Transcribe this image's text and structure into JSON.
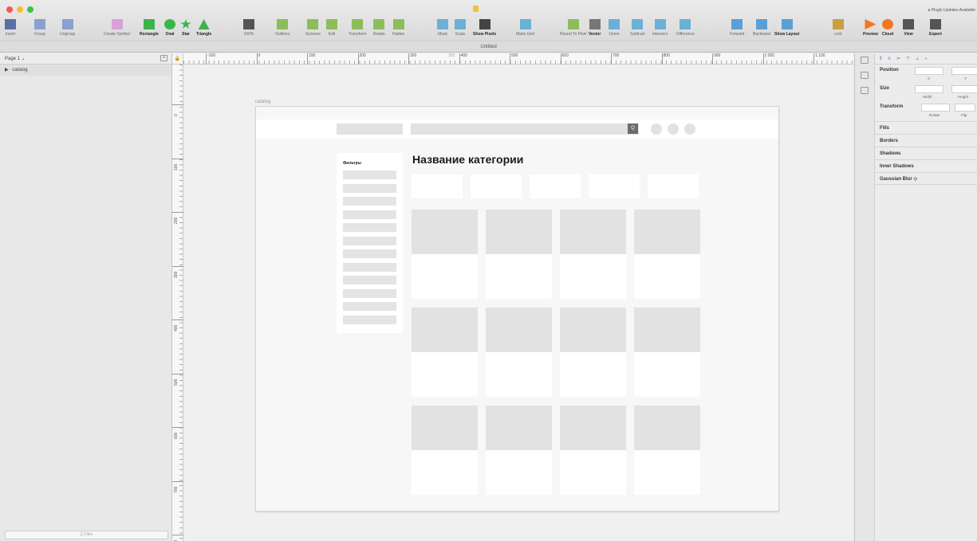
{
  "window": {
    "title": "Untitled",
    "notification": "● Plugin Updates Available"
  },
  "toolbar": {
    "tools": [
      {
        "label": "Insert",
        "icon": "plus-dropdown-icon",
        "color": "#5a6fa8"
      },
      {
        "label": "Group",
        "icon": "group-icon",
        "color": "#8aa0cf"
      },
      {
        "label": "Ungroup",
        "icon": "ungroup-icon",
        "color": "#8aa0cf"
      },
      {
        "label": "Create Symbol",
        "icon": "symbol-icon",
        "color": "#d9a0d9"
      },
      {
        "label": "Rectangle",
        "icon": "rectangle-icon",
        "color": "#3cb44b"
      },
      {
        "label": "Oval",
        "icon": "oval-icon",
        "color": "#3cb44b"
      },
      {
        "label": "Star",
        "icon": "star-icon",
        "color": "#3cb44b"
      },
      {
        "label": "Triangle",
        "icon": "triangle-icon",
        "color": "#3cb44b"
      },
      {
        "label": "100%",
        "icon": "zoom-icon",
        "color": "#555555"
      },
      {
        "label": "Outlines",
        "icon": "outlines-icon",
        "color": "#8dbd5a"
      },
      {
        "label": "Scissors",
        "icon": "scissors-icon",
        "color": "#8dbd5a"
      },
      {
        "label": "Edit",
        "icon": "edit-icon",
        "color": "#8dbd5a"
      },
      {
        "label": "Transform",
        "icon": "transform-icon",
        "color": "#8dbd5a"
      },
      {
        "label": "Rotate",
        "icon": "rotate-icon",
        "color": "#8dbd5a"
      },
      {
        "label": "Flatten",
        "icon": "flatten-icon",
        "color": "#8dbd5a"
      },
      {
        "label": "Mask",
        "icon": "mask-icon",
        "color": "#6bb0d6"
      },
      {
        "label": "Scale",
        "icon": "scale-icon",
        "color": "#6bb0d6"
      },
      {
        "label": "Show Pixels",
        "icon": "pixels-icon",
        "color": "#444444"
      },
      {
        "label": "Make Grid",
        "icon": "grid-icon",
        "color": "#6bb0d6"
      },
      {
        "label": "Round To Pixel",
        "icon": "round-pixel-icon",
        "color": "#8dbd5a"
      },
      {
        "label": "Vector",
        "icon": "vector-pen-icon",
        "color": "#777777"
      },
      {
        "label": "Union",
        "icon": "union-icon",
        "color": "#6bb0d6"
      },
      {
        "label": "Subtract",
        "icon": "subtract-icon",
        "color": "#6bb0d6"
      },
      {
        "label": "Intersect",
        "icon": "intersect-icon",
        "color": "#6bb0d6"
      },
      {
        "label": "Difference",
        "icon": "difference-icon",
        "color": "#6bb0d6"
      },
      {
        "label": "Forward",
        "icon": "forward-icon",
        "color": "#5aa0d6"
      },
      {
        "label": "Backward",
        "icon": "backward-icon",
        "color": "#5aa0d6"
      },
      {
        "label": "Show Layout",
        "icon": "layout-icon",
        "color": "#5aa0d6"
      },
      {
        "label": "Link",
        "icon": "link-icon",
        "color": "#c8a040"
      },
      {
        "label": "Preview",
        "icon": "preview-play-icon",
        "color": "#f07820"
      },
      {
        "label": "Cloud",
        "icon": "cloud-icon",
        "color": "#f07820"
      },
      {
        "label": "View",
        "icon": "view-icon",
        "color": "#555555"
      },
      {
        "label": "Export",
        "icon": "export-icon",
        "color": "#555555"
      }
    ]
  },
  "layers": {
    "page_label": "Page 1 ⌄",
    "add_page": "+",
    "items": [
      {
        "name": "catalog",
        "caret": "▶"
      }
    ],
    "filter_placeholder": "Q Filter"
  },
  "rulers": {
    "h_ticks": [
      "-100",
      "0",
      "100",
      "200",
      "300",
      "400",
      "500",
      "600",
      "700",
      "800",
      "900",
      "1 000",
      "1 100"
    ],
    "h_selection": "355",
    "v_ticks": [
      "0",
      "100",
      "200",
      "300",
      "400",
      "500",
      "600",
      "700",
      "800"
    ]
  },
  "artboard": {
    "name": "catalog",
    "search_icon": "Q",
    "filters_title": "Фильтры",
    "category_title": "Название категории"
  },
  "inspector": {
    "align_icons": "⫴ ≡ ⊨ ⊤ ⊥ ⊦",
    "position_label": "Position",
    "x_label": "X",
    "y_label": "Y",
    "size_label": "Size",
    "width_label": "Width",
    "height_label": "Height",
    "transform_label": "Transform",
    "rotate_label": "Rotate",
    "flip_label": "Flip",
    "sections": [
      "Fills",
      "Borders",
      "Shadows",
      "Inner Shadows",
      "Gaussian Blur ◇"
    ]
  }
}
